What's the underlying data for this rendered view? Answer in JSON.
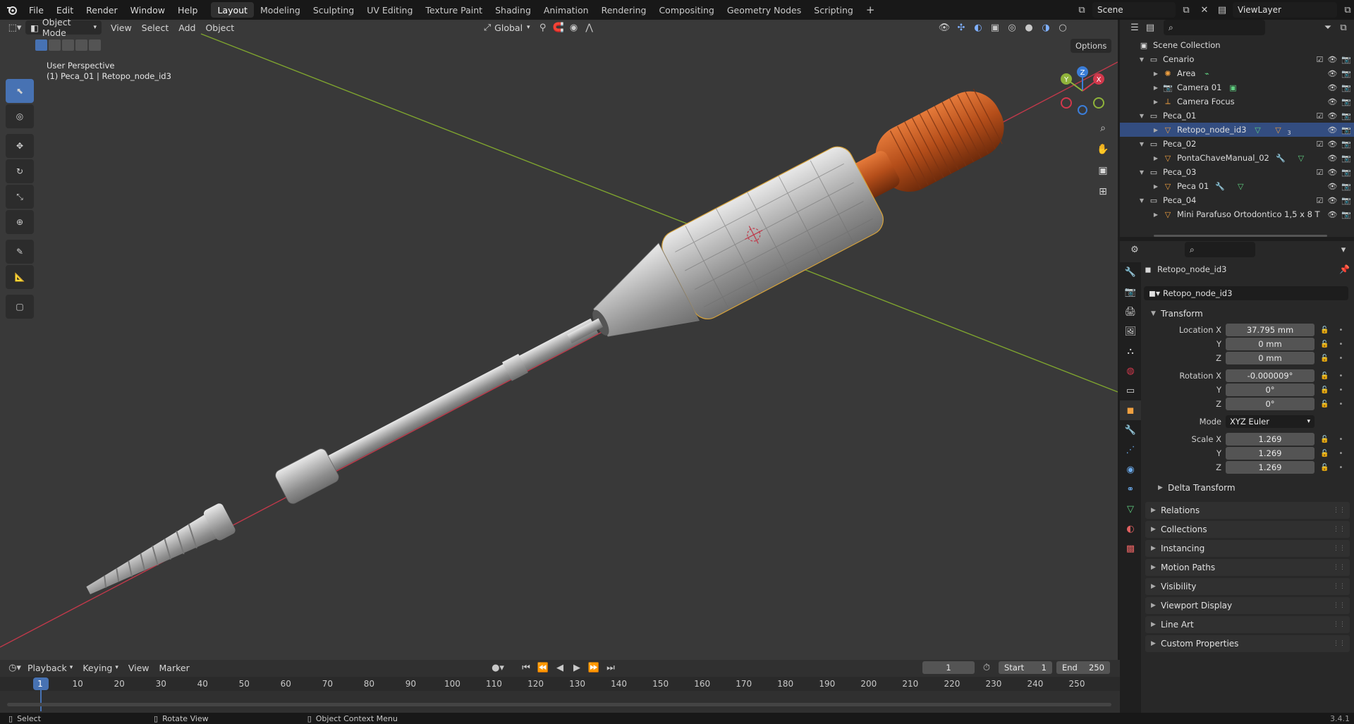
{
  "menus": [
    "File",
    "Edit",
    "Render",
    "Window",
    "Help"
  ],
  "workspaces": [
    "Layout",
    "Modeling",
    "Sculpting",
    "UV Editing",
    "Texture Paint",
    "Shading",
    "Animation",
    "Rendering",
    "Compositing",
    "Geometry Nodes",
    "Scripting"
  ],
  "scene": "Scene",
  "view_layer": "ViewLayer",
  "viewport": {
    "mode": "Object Mode",
    "menus": [
      "View",
      "Select",
      "Add",
      "Object"
    ],
    "orientation": "Global",
    "options": "Options",
    "perspective": "User Perspective",
    "context": "(1) Peca_01 | Retopo_node_id3",
    "gizmo_x": "X",
    "gizmo_y": "Y",
    "gizmo_z": "Z"
  },
  "outliner": {
    "root": "Scene Collection",
    "rows": [
      {
        "label": "Cenario",
        "level": 1,
        "type": "collection"
      },
      {
        "label": "Area",
        "level": 2,
        "type": "light"
      },
      {
        "label": "Camera 01",
        "level": 2,
        "type": "camera"
      },
      {
        "label": "Camera Focus",
        "level": 2,
        "type": "empty"
      },
      {
        "label": "Peca_01",
        "level": 1,
        "type": "collection"
      },
      {
        "label": "Retopo_node_id3",
        "level": 2,
        "type": "mesh"
      },
      {
        "label": "Peca_02",
        "level": 1,
        "type": "collection"
      },
      {
        "label": "PontaChaveManual_02",
        "level": 2,
        "type": "mesh"
      },
      {
        "label": "Peca_03",
        "level": 1,
        "type": "collection"
      },
      {
        "label": "Peca 01",
        "level": 2,
        "type": "mesh"
      },
      {
        "label": "Peca_04",
        "level": 1,
        "type": "collection"
      },
      {
        "label": "Mini Parafuso Ortodontico 1,5 x 8 T",
        "level": 2,
        "type": "mesh"
      }
    ],
    "badge_count": "3"
  },
  "properties": {
    "object_name": "Retopo_node_id3",
    "data_name": "Retopo_node_id3",
    "transform_label": "Transform",
    "location": {
      "label_x": "Location X",
      "x": "37.795 mm",
      "y": "0 mm",
      "z": "0 mm"
    },
    "rotation": {
      "label_x": "Rotation X",
      "x": "-0.000009°",
      "y": "0°",
      "z": "0°"
    },
    "mode_label": "Mode",
    "mode": "XYZ Euler",
    "scale": {
      "label_x": "Scale X",
      "x": "1.269",
      "y": "1.269",
      "z": "1.269"
    },
    "axis_y": "Y",
    "axis_z": "Z",
    "delta": "Delta Transform",
    "panels": [
      "Relations",
      "Collections",
      "Instancing",
      "Motion Paths",
      "Visibility",
      "Viewport Display",
      "Line Art",
      "Custom Properties"
    ]
  },
  "timeline": {
    "menus": [
      "Playback",
      "Keying",
      "View",
      "Marker"
    ],
    "current_frame": "1",
    "start_label": "Start",
    "start": "1",
    "end_label": "End",
    "end": "250",
    "ticks": [
      "1",
      "10",
      "20",
      "30",
      "40",
      "50",
      "60",
      "70",
      "80",
      "90",
      "100",
      "110",
      "120",
      "130",
      "140",
      "150",
      "160",
      "170",
      "180",
      "190",
      "200",
      "210",
      "220",
      "230",
      "240",
      "250"
    ]
  },
  "status": {
    "select": "Select",
    "rotate": "Rotate View",
    "context_menu": "Object Context Menu",
    "version": "3.4.1"
  },
  "colors": {
    "accent": "#4772b3",
    "header": "#303030",
    "viewport": "#393939",
    "x_axis": "#d2384c",
    "y_axis": "#8fb33a"
  }
}
